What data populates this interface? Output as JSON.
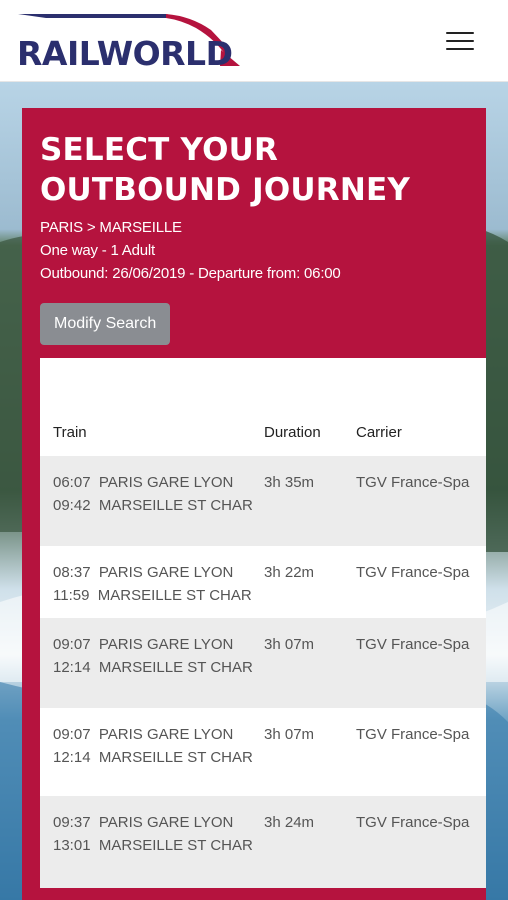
{
  "header": {
    "logo_text": "RAILWORLD",
    "menu_icon": "hamburger-menu-icon"
  },
  "journey": {
    "title": "SELECT YOUR OUTBOUND JOURNEY",
    "route": "PARIS > MARSEILLE",
    "trip_type": "One way - 1 Adult",
    "outbound": "Outbound: 26/06/2019 - Departure from: 06:00",
    "modify_label": "Modify Search"
  },
  "table": {
    "headers": {
      "train": "Train",
      "duration": "Duration",
      "carrier": "Carrier"
    },
    "rows": [
      {
        "dep_time": "06:07",
        "dep_station": "PARIS GARE LYON",
        "arr_time": "09:42",
        "arr_station": "MARSEILLE ST CHAR",
        "duration": "3h 35m",
        "carrier": "TGV France-Spa"
      },
      {
        "dep_time": "08:37",
        "dep_station": "PARIS GARE LYON",
        "arr_time": "11:59",
        "arr_station": "MARSEILLE ST CHAR",
        "duration": "3h 22m",
        "carrier": "TGV France-Spa"
      },
      {
        "dep_time": "09:07",
        "dep_station": "PARIS GARE LYON",
        "arr_time": "12:14",
        "arr_station": "MARSEILLE ST CHAR",
        "duration": "3h 07m",
        "carrier": "TGV France-Spa"
      },
      {
        "dep_time": "09:07",
        "dep_station": "PARIS GARE LYON",
        "arr_time": "12:14",
        "arr_station": "MARSEILLE ST CHAR",
        "duration": "3h 07m",
        "carrier": "TGV France-Spa"
      },
      {
        "dep_time": "09:37",
        "dep_station": "PARIS GARE LYON",
        "arr_time": "13:01",
        "arr_station": "MARSEILLE ST CHAR",
        "duration": "3h 24m",
        "carrier": "TGV France-Spa"
      }
    ]
  },
  "colors": {
    "brand_red": "#b5133e",
    "brand_navy": "#2b2f6e",
    "button_gray": "#8a8d92",
    "row_alt": "#ececec"
  }
}
